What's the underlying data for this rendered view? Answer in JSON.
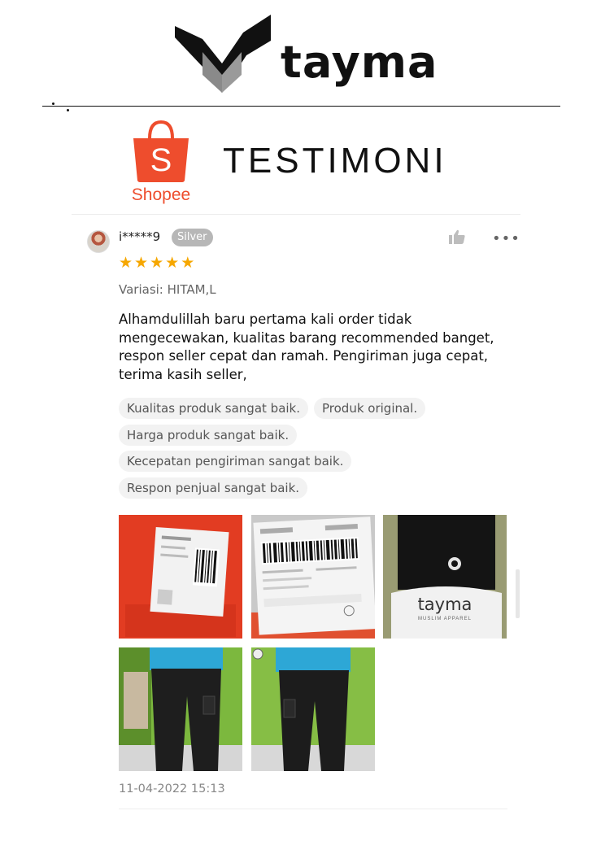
{
  "header": {
    "brand_name": "tayma"
  },
  "banner": {
    "marketplace_label": "Shopee",
    "title": "TESTIMONI"
  },
  "review": {
    "username": "i*****9",
    "badge": "Silver",
    "rating": 5,
    "stars": [
      "★",
      "★",
      "★",
      "★",
      "★"
    ],
    "variant": "Variasi: HITAM,L",
    "text": "Alhamdulillah baru pertama kali order tidak mengecewakan, kualitas barang recommended banget, respon seller cepat dan ramah. Pengiriman juga cepat, terima kasih seller,",
    "tags": [
      "Kualitas produk sangat baik.",
      "Produk original.",
      "Harga produk sangat baik.",
      "Kecepatan pengiriman sangat baik.",
      "Respon penjual sangat baik."
    ],
    "photo_brand": "tayma",
    "photo_brand_sub": "MUSLIM APPAREL",
    "timestamp": "11-04-2022 15:13"
  },
  "icons": {
    "like": "thumbs-up-icon",
    "more": "more-dots-icon"
  },
  "colors": {
    "shopee_orange": "#ee4d2d",
    "star": "#f6a700",
    "badge_bg": "#b7b7b7"
  }
}
